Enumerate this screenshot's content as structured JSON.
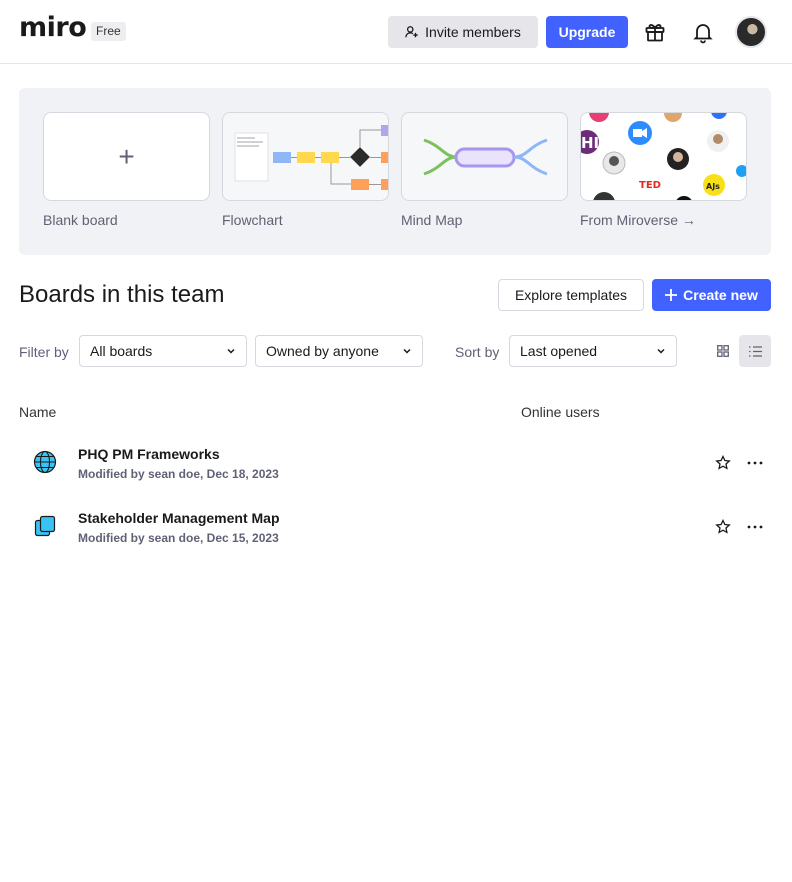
{
  "header": {
    "logo": "miro",
    "plan_badge": "Free",
    "invite_label": "Invite members",
    "upgrade_label": "Upgrade",
    "icons": [
      "person-add-icon",
      "gift-icon",
      "bell-icon"
    ]
  },
  "templates": [
    {
      "label": "Blank board"
    },
    {
      "label": "Flowchart"
    },
    {
      "label": "Mind Map"
    },
    {
      "label": "From Miroverse →"
    }
  ],
  "miroverse_logos": [
    "HI",
    "TED",
    "AJs"
  ],
  "main": {
    "title": "Boards in this team",
    "explore_label": "Explore templates",
    "create_label": "Create new"
  },
  "filters": {
    "filter_by_label": "Filter by",
    "filter_value": "All boards",
    "owner_value": "Owned by anyone",
    "sort_by_label": "Sort by",
    "sort_value": "Last opened"
  },
  "table": {
    "columns": [
      "Name",
      "Online users"
    ],
    "rows": [
      {
        "title": "PHQ PM Frameworks",
        "subtitle": "Modified by sean doe, Dec 18, 2023",
        "icon": "globe-icon"
      },
      {
        "title": "Stakeholder Management Map",
        "subtitle": "Modified by sean doe, Dec 15, 2023",
        "icon": "stacked-boards-icon"
      }
    ]
  },
  "colors": {
    "accent": "#4262ff",
    "muted_text": "#5f6276",
    "panel_bg": "#f1f2f5",
    "border": "#d6d8e0"
  }
}
